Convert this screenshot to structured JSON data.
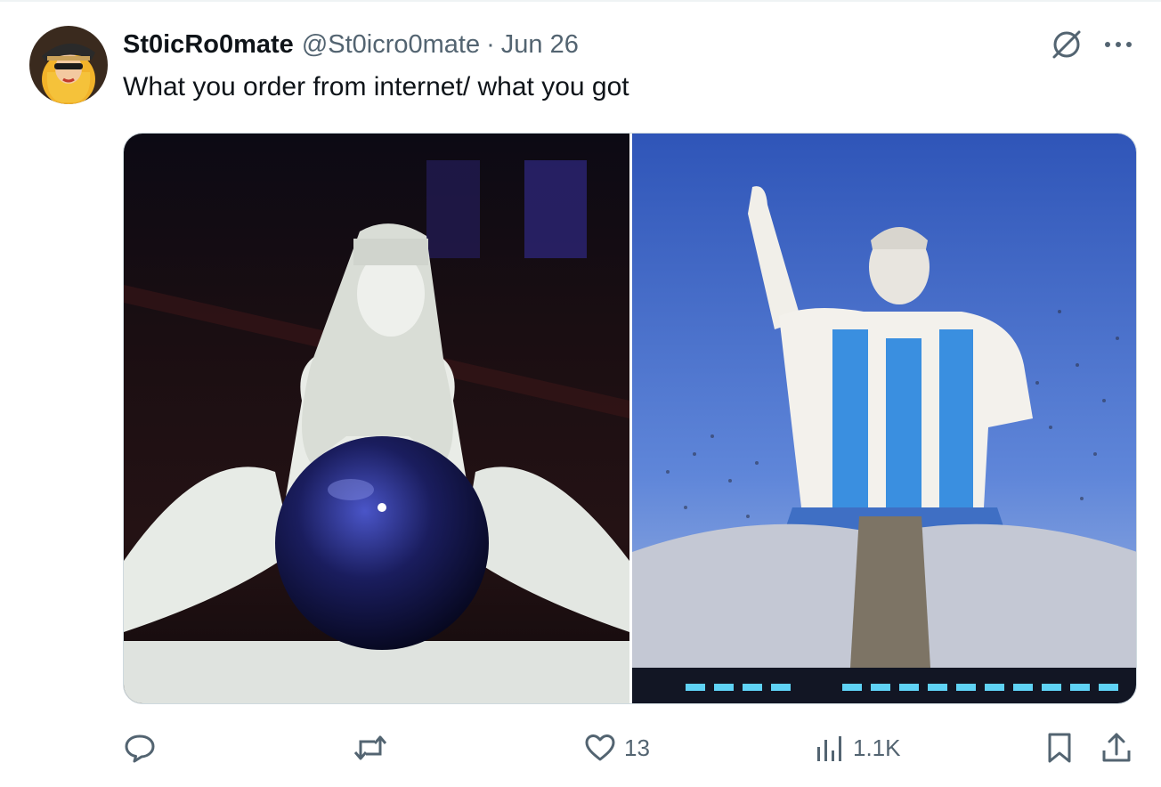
{
  "tweet": {
    "author": {
      "display_name": "St0icRo0mate",
      "handle": "@St0icro0mate",
      "avatar_icon": "avatar-image"
    },
    "separator": "·",
    "date": "Jun 26",
    "text": "What you order from internet/ what you got",
    "media": {
      "count": 2,
      "left_image": "white sculpture of a seated woman holding a dark blue mirrored sphere",
      "right_image": "giant statue of a footballer in a sky-blue and white striped shirt with confetti"
    },
    "actions": {
      "reply": {
        "icon": "reply-icon",
        "count": ""
      },
      "repost": {
        "icon": "repost-icon",
        "count": ""
      },
      "like": {
        "icon": "heart-icon",
        "count": "13"
      },
      "views": {
        "icon": "views-icon",
        "count": "1.1K"
      },
      "bookmark": {
        "icon": "bookmark-icon"
      },
      "share": {
        "icon": "share-icon"
      }
    },
    "header_icons": [
      "grok-icon",
      "more-icon"
    ],
    "colors": {
      "text": "#0f1419",
      "secondary": "#536471",
      "border": "#cfd9de"
    }
  }
}
